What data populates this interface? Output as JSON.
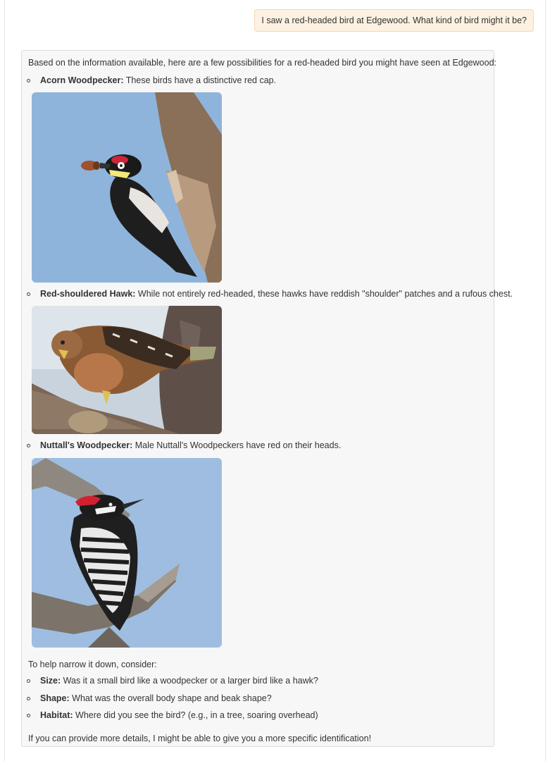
{
  "user_message": "I saw a red-headed bird at Edgewood. What kind of bird might it be?",
  "response": {
    "intro": "Based on the information available, here are a few possibilities for a red-headed bird you might have seen at Edgewood:",
    "birds": [
      {
        "name": "Acorn Woodpecker:",
        "description": "These birds have a distinctive red cap.",
        "photo_icon": "acorn-woodpecker-photo"
      },
      {
        "name": "Red-shouldered Hawk:",
        "description": "While not entirely red-headed, these hawks have reddish \"shoulder\" patches and a rufous chest.",
        "photo_icon": "red-shouldered-hawk-photo"
      },
      {
        "name": "Nuttall's Woodpecker:",
        "description": "Male Nuttall's Woodpeckers have red on their heads.",
        "photo_icon": "nuttalls-woodpecker-photo"
      }
    ],
    "narrow_intro": "To help narrow it down, consider:",
    "questions": [
      {
        "label": "Size:",
        "text": "Was it a small bird like a woodpecker or a larger bird like a hawk?"
      },
      {
        "label": "Shape:",
        "text": "What was the overall body shape and beak shape?"
      },
      {
        "label": "Habitat:",
        "text": "Where did you see the bird? (e.g., in a tree, soaring overhead)"
      }
    ],
    "closing": "If you can provide more details, I might be able to give you a more specific identification!"
  },
  "colors": {
    "user_bubble_bg": "#fdf1e1",
    "card_bg": "#f7f7f7",
    "sky_blue": "#8fb4dc"
  }
}
